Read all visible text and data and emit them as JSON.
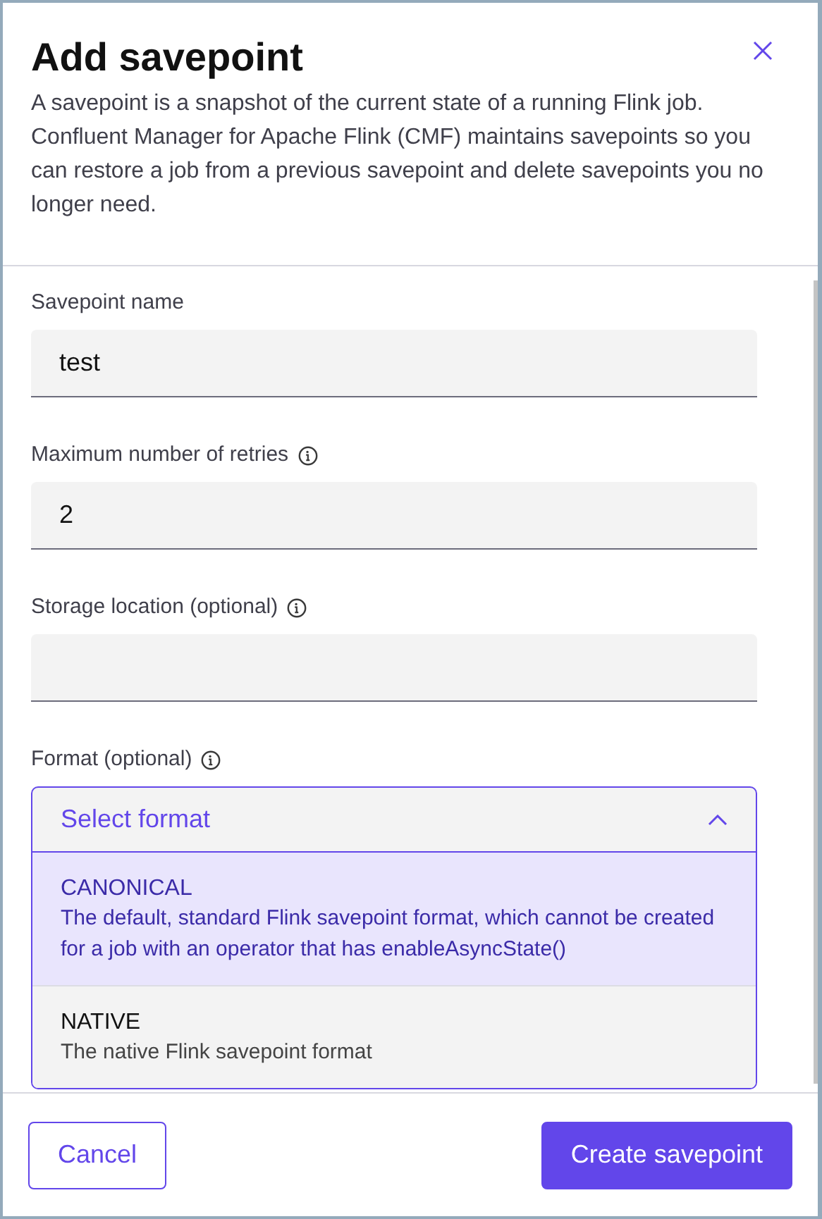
{
  "dialog": {
    "title": "Add savepoint",
    "description": "A savepoint is a snapshot of the current state of a running Flink job. Confluent Manager for Apache Flink (CMF) maintains savepoints so you can restore a job from a previous savepoint and delete savepoints you no longer need."
  },
  "fields": [
    {
      "label": "Savepoint name",
      "info": false,
      "value": "test"
    },
    {
      "label": "Maximum number of retries",
      "info": true,
      "value": "2"
    },
    {
      "label": "Storage location (optional)",
      "info": true
    }
  ],
  "format": {
    "label": "Format (optional)",
    "info": true,
    "placeholder": "Select format",
    "expanded": true,
    "options": [
      {
        "name": "CANONICAL",
        "description": "The default, standard Flink savepoint format, which cannot be created for a job with an operator that has enableAsyncState()",
        "selected": true
      },
      {
        "name": "NATIVE",
        "description": "The native Flink savepoint format",
        "selected": false
      }
    ]
  },
  "buttons": [
    {
      "label": "Cancel",
      "kind": "secondary"
    },
    {
      "label": "Create savepoint",
      "kind": "primary"
    }
  ]
}
